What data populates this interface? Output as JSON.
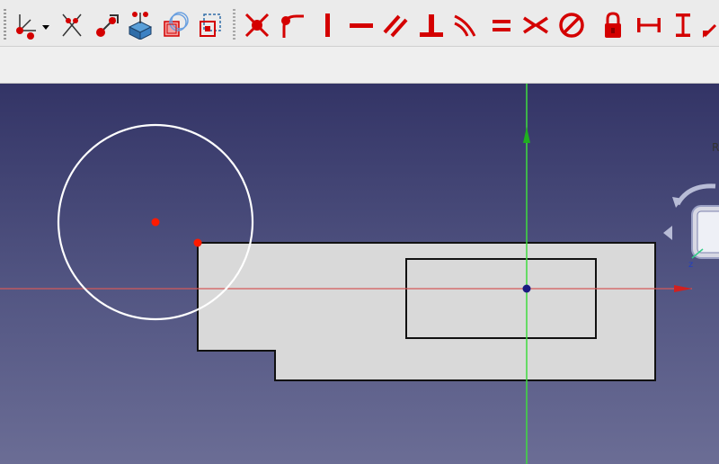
{
  "toolbar": {
    "buttons": [
      {
        "name": "constrain-coincident-unified-button",
        "icon": "coincident-unified-icon"
      },
      {
        "name": "constrain-point-on-object-button",
        "icon": "point-on-object-icon"
      },
      {
        "name": "constrain-point-on-point-button",
        "icon": "point-on-point-icon"
      },
      {
        "name": "external-geometry-button",
        "icon": "external-geometry-icon"
      },
      {
        "name": "carbon-copy-button",
        "icon": "carbon-copy-icon"
      },
      {
        "name": "toggle-construction-button",
        "icon": "construction-toggle-icon"
      },
      {
        "name": "constrain-coincident-button",
        "icon": "coincident-icon"
      },
      {
        "name": "constrain-tangent-button",
        "icon": "tangent-icon"
      },
      {
        "name": "constrain-vertical-button",
        "icon": "vertical-icon"
      },
      {
        "name": "constrain-horizontal-button",
        "icon": "horizontal-icon"
      },
      {
        "name": "constrain-parallel-button",
        "icon": "parallel-icon"
      },
      {
        "name": "constrain-perpendicular-button",
        "icon": "perpendicular-icon"
      },
      {
        "name": "constrain-tangent-curve-button",
        "icon": "tangent-curve-icon"
      },
      {
        "name": "constrain-equal-button",
        "icon": "equal-icon"
      },
      {
        "name": "constrain-symmetric-button",
        "icon": "symmetric-icon"
      },
      {
        "name": "constrain-block-button",
        "icon": "block-icon"
      },
      {
        "name": "constrain-lock-button",
        "icon": "lock-icon"
      },
      {
        "name": "constrain-horizontal-distance-button",
        "icon": "horizontal-distance-icon"
      },
      {
        "name": "constrain-vertical-distance-button",
        "icon": "vertical-distance-icon"
      },
      {
        "name": "constrain-distance-button",
        "icon": "distance-icon"
      }
    ]
  },
  "viewport": {
    "background_top": "#333466",
    "background_bottom": "#6b6d95",
    "x_axis_color": "#d45a5a",
    "y_axis_color": "#3fdc3f",
    "geometry_color": "#ffffff",
    "profile_fill": "#d9d9d9",
    "profile_stroke": "#111111",
    "point_color": "#ff1a00",
    "origin_color": "#1a1a80"
  },
  "navcube": {
    "face_label": "R"
  }
}
